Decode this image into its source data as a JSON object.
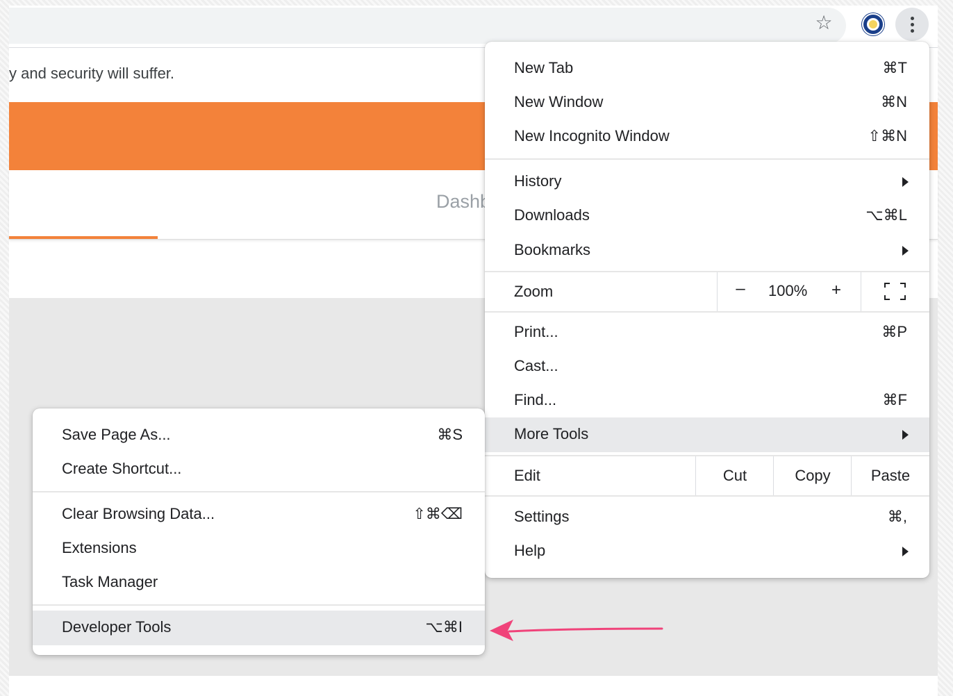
{
  "page": {
    "warning_text": "y and security will suffer.",
    "tab_partial_label": "Dashb"
  },
  "toolbar": {
    "icons": [
      "star-icon",
      "extension-icon",
      "more-options-icon"
    ]
  },
  "main_menu": {
    "new_tab": {
      "label": "New Tab",
      "shortcut": "⌘T"
    },
    "new_window": {
      "label": "New Window",
      "shortcut": "⌘N"
    },
    "new_incognito": {
      "label": "New Incognito Window",
      "shortcut": "⇧⌘N"
    },
    "history": {
      "label": "History"
    },
    "downloads": {
      "label": "Downloads",
      "shortcut": "⌥⌘L"
    },
    "bookmarks": {
      "label": "Bookmarks"
    },
    "zoom": {
      "label": "Zoom",
      "minus": "–",
      "value": "100%",
      "plus": "+"
    },
    "print": {
      "label": "Print...",
      "shortcut": "⌘P"
    },
    "cast": {
      "label": "Cast..."
    },
    "find": {
      "label": "Find...",
      "shortcut": "⌘F"
    },
    "more_tools": {
      "label": "More Tools"
    },
    "edit": {
      "label": "Edit",
      "cut": "Cut",
      "copy": "Copy",
      "paste": "Paste"
    },
    "settings": {
      "label": "Settings",
      "shortcut": "⌘,"
    },
    "help": {
      "label": "Help"
    }
  },
  "sub_menu": {
    "save_page": {
      "label": "Save Page As...",
      "shortcut": "⌘S"
    },
    "create_shortcut": {
      "label": "Create Shortcut..."
    },
    "clear_data": {
      "label": "Clear Browsing Data...",
      "shortcut": "⇧⌘⌫"
    },
    "extensions": {
      "label": "Extensions"
    },
    "task_manager": {
      "label": "Task Manager"
    },
    "developer_tools": {
      "label": "Developer Tools",
      "shortcut": "⌥⌘I"
    }
  },
  "colors": {
    "accent_orange": "#f3823a",
    "highlight": "#e8e9eb",
    "annotation_arrow": "#f0437a"
  }
}
